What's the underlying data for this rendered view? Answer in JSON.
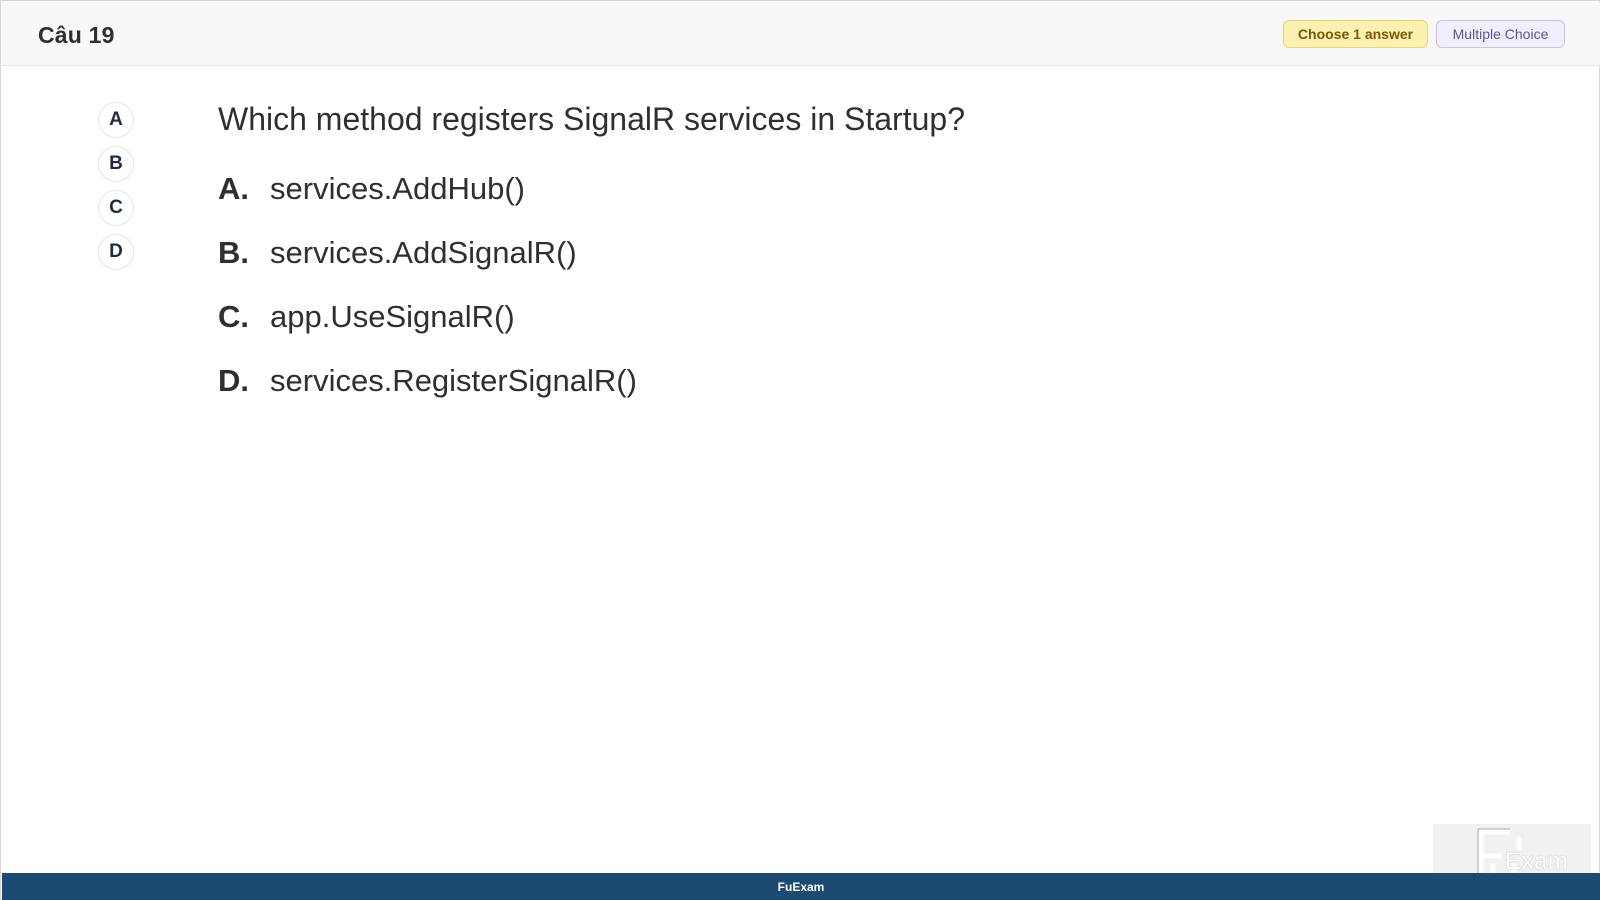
{
  "header": {
    "question_label": "Câu 19",
    "badge_choose": "Choose 1 answer",
    "badge_type": "Multiple Choice"
  },
  "answer_nav": [
    "A",
    "B",
    "C",
    "D"
  ],
  "question": {
    "text": "Which method registers SignalR services in Startup?",
    "options": [
      {
        "letter": "A.",
        "text": "services.AddHub()"
      },
      {
        "letter": "B.",
        "text": "services.AddSignalR()"
      },
      {
        "letter": "C.",
        "text": "app.UseSignalR()"
      },
      {
        "letter": "D.",
        "text": "services.RegisterSignalR()"
      }
    ]
  },
  "watermark": {
    "text": "Exam"
  },
  "footer": {
    "brand": "FuExam"
  }
}
